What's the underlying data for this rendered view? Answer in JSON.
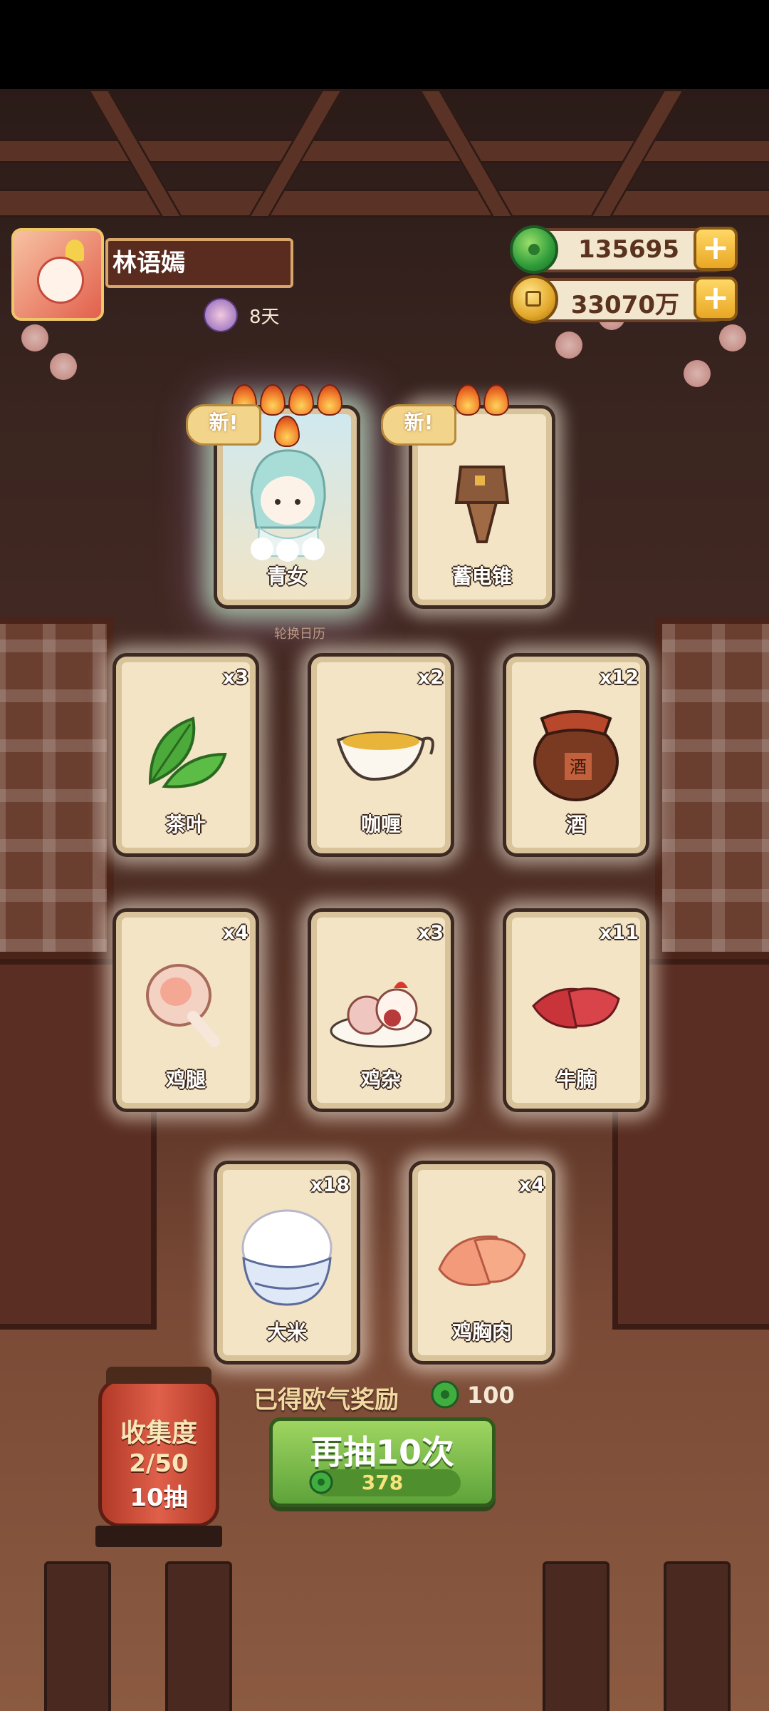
{
  "player": {
    "name": "林语嫣",
    "days": "8天"
  },
  "currency": {
    "jade": {
      "value": "135695",
      "icon": "jade-coin-icon"
    },
    "gold": {
      "value": "33070万",
      "icon": "gold-coin-icon"
    }
  },
  "new_badge": "新!",
  "rotate_note": "轮换日历",
  "cards": [
    {
      "name": "青女",
      "qty": "",
      "is_new": true,
      "flames": 5,
      "icon": "qingnu-character-icon"
    },
    {
      "name": "蓄电锥",
      "qty": "",
      "is_new": true,
      "flames": 2,
      "icon": "drill-icon"
    },
    {
      "name": "茶叶",
      "qty": "x3",
      "icon": "tea-leaf-icon"
    },
    {
      "name": "咖喱",
      "qty": "x2",
      "icon": "curry-icon"
    },
    {
      "name": "酒",
      "qty": "x12",
      "icon": "wine-jar-icon"
    },
    {
      "name": "鸡腿",
      "qty": "x4",
      "icon": "chicken-leg-icon"
    },
    {
      "name": "鸡杂",
      "qty": "x3",
      "icon": "chicken-offal-icon"
    },
    {
      "name": "牛腩",
      "qty": "x11",
      "icon": "beef-icon"
    },
    {
      "name": "大米",
      "qty": "x18",
      "icon": "rice-icon"
    },
    {
      "name": "鸡胸肉",
      "qty": "x4",
      "icon": "chicken-breast-icon"
    }
  ],
  "wine_jar_mark": "酒",
  "reward": {
    "label": "已得欧气奖励",
    "value": "100"
  },
  "draw_button": {
    "label": "再抽10次",
    "cost": "378"
  },
  "collection": {
    "label": "收集度",
    "progress": "2/50",
    "draws": "10抽"
  },
  "colors": {
    "accent_green": "#5ea33a",
    "gold": "#e9a623",
    "card_bg": "#f2e4c5"
  }
}
